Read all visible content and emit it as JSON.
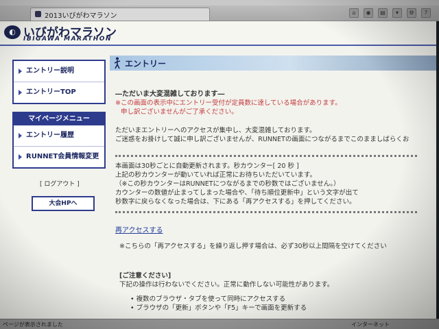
{
  "browser": {
    "tab_title": "2013いびがわマラソン",
    "status_text": "ページが表示されました",
    "status_zone": "インターネット"
  },
  "site": {
    "logo_text": "いびがわマラソン",
    "logo_sub": "IBIGAWA MARATHON"
  },
  "sidebar": {
    "top_items": [
      {
        "label": "エントリー説明"
      },
      {
        "label": "エントリーTOP"
      }
    ],
    "mypage_header": "マイページメニュー",
    "mypage_items": [
      {
        "label": "エントリー履歴"
      },
      {
        "label": "RUNNET会員情報変更"
      }
    ],
    "logout": "[ ログアウト ]",
    "taikai_button": "大会HPへ"
  },
  "main": {
    "section_title": "エントリー",
    "heading": "―ただいま大変混雑しております―",
    "warning_lines": [
      "※この画面の表示中にエントリー受付が定員数に達している場合があります。",
      "申し訳ございませんがご了承ください。"
    ],
    "intro_lines": [
      "ただいまエントリーへのアクセスが集中し、大変混雑しております。",
      "ご迷惑をお掛けして誠に申し訳ございませんが、RUNNETの画面につながるまでこのまましばらくお"
    ],
    "counter_lines": [
      "本画面は30秒ごとに自動更新されます。秒カウンター[ 20 秒 ]",
      "上記の秒カウンターが動いていれば正常にお待ちいただいています。",
      "（※この秒カウンターはRUNNETにつながるまでの秒数ではございません。）",
      "カウンターの数値が止まってしまった場合や、「待ち順位更新中」という文字が出て",
      "秒数字に戻らなくなった場合は、下にある「再アクセスする」を押してください。"
    ],
    "reaccess_link": "再アクセスする",
    "reaccess_note": "※こちらの「再アクセスする」を繰り返し押す場合は、必ず30秒以上間隔を空けてください",
    "caution_heading": "[ご注意ください]",
    "caution_intro": "下記の操作は行わないでください。正常に動作しない可能性があります。",
    "caution_items": [
      "複数のブラウザ・タブを使って同時にアクセスする",
      "ブラウザの「更新」ボタンや「F5」キーで画面を更新する"
    ]
  },
  "colors": {
    "brand_navy": "#1b2760",
    "nav_border": "#2d3b8d",
    "warning_red": "#c23a3a",
    "link_blue": "#1f3c9a"
  }
}
